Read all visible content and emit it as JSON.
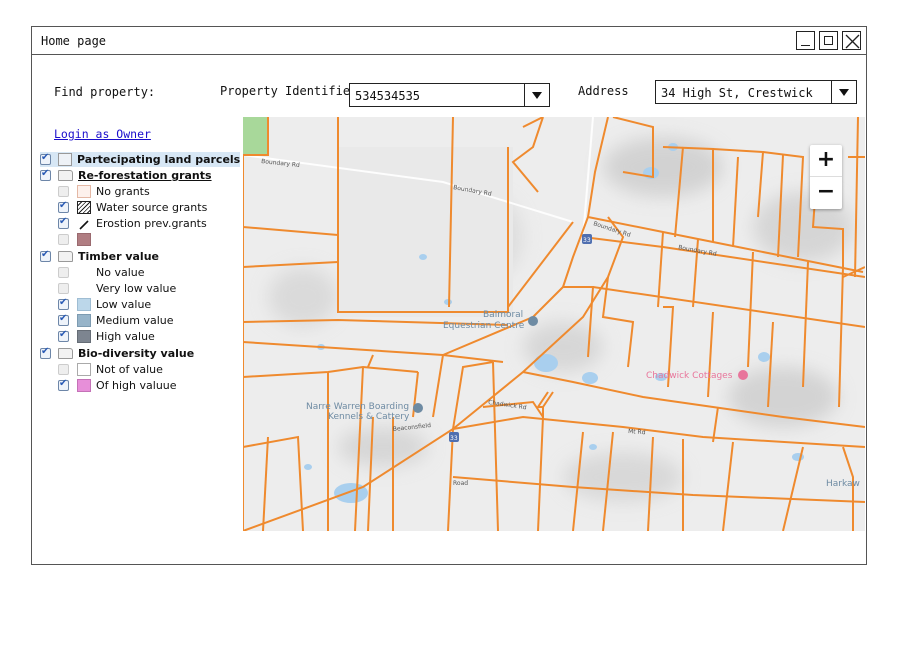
{
  "window": {
    "title": "Home page"
  },
  "search": {
    "find_label": "Find property:",
    "id_label": "Property Identifier",
    "id_value": "534534535",
    "address_label": "Address",
    "address_value": "34 High St, Crestwick"
  },
  "login_link": "Login as Owner",
  "legend": {
    "participating": "Partecipating land parcels",
    "reforestation": {
      "title": "Re-forestation grants",
      "items": [
        "No grants",
        "Water source grants",
        "Erostion prev.grants",
        ""
      ]
    },
    "timber": {
      "title": "Timber value",
      "items": [
        "No value",
        "Very low value",
        "Low value",
        "Medium value",
        "High value"
      ]
    },
    "biodiversity": {
      "title": "Bio-diversity value",
      "items": [
        "Not of value",
        "Of high valuue"
      ]
    }
  },
  "map": {
    "labels": {
      "boundary_rd_1": "Boundary Rd",
      "boundary_rd_2": "Boundary Rd",
      "boundary_rd_3": "Boundary Rd",
      "boundary_rd_4": "Boundary Rd",
      "balmoral": "Balmoral",
      "equestrian": "Equestrian Centre",
      "chadwick": "Chadwick Cottages",
      "narre1": "Narre Warren Boarding",
      "narre2": "Kennels & Cattery",
      "harkaway": "Harkaw",
      "beaconsfield": "Beaconsfield",
      "chadwick_rd": "Chadwick Rd",
      "mt_rd": "Mt Rd",
      "road_a": "Road",
      "shield1": "33",
      "shield2": "33"
    },
    "zoom_in": "+",
    "zoom_out": "−"
  },
  "colors": {
    "road": "#ef8a2e",
    "water": "#a9cfee",
    "park": "#a8d89a",
    "timber_low": "#bcd7ea",
    "timber_medium": "#97b4c9",
    "timber_high": "#7d8590",
    "bio_high": "#e78fd9",
    "grant_extra": "#b07d82",
    "no_grants": "#fdf1ec",
    "pin": "#e8759b",
    "poi": "#6e8ba3"
  }
}
